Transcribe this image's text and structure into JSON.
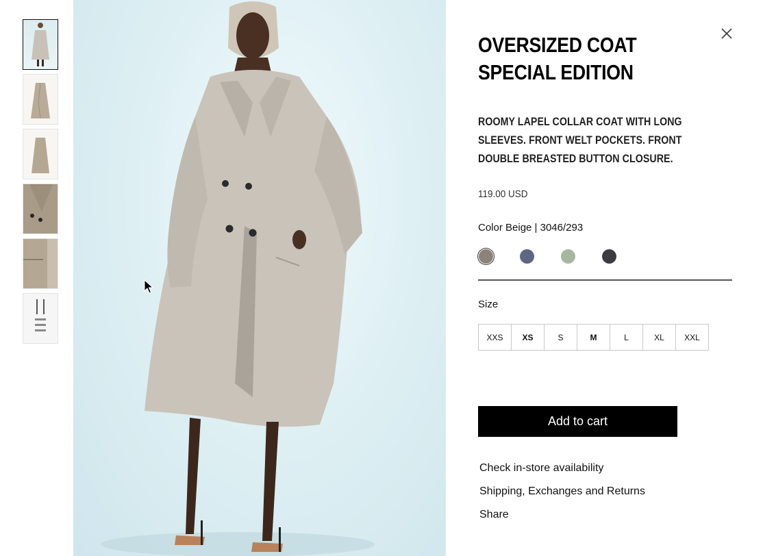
{
  "product": {
    "title": "OVERSIZED COAT SPECIAL EDITION",
    "description": "ROOMY LAPEL COLLAR COAT WITH LONG SLEEVES. FRONT WELT POCKETS. FRONT DOUBLE BREASTED BUTTON CLOSURE.",
    "price": "119.00 USD",
    "color_label": "Color Beige | 3046/293"
  },
  "colors": [
    {
      "hex": "#8b8279",
      "selected": true
    },
    {
      "hex": "#5f6683",
      "selected": false
    },
    {
      "hex": "#a6b79e",
      "selected": false
    },
    {
      "hex": "#3b3b40",
      "selected": false
    }
  ],
  "size_label": "Size",
  "sizes": [
    "XXS",
    "XS",
    "S",
    "M",
    "L",
    "XL",
    "XXL"
  ],
  "add_to_cart": "Add to cart",
  "links": {
    "availability": "Check in-store availability",
    "shipping": "Shipping, Exchanges and Returns",
    "share": "Share"
  },
  "icons": {
    "close": "close-icon",
    "cursor": "mouse-cursor-icon"
  },
  "brand_colors": {
    "button_bg": "#000000",
    "coat": "#c9c3ba",
    "backdrop": "#dff0f4"
  }
}
